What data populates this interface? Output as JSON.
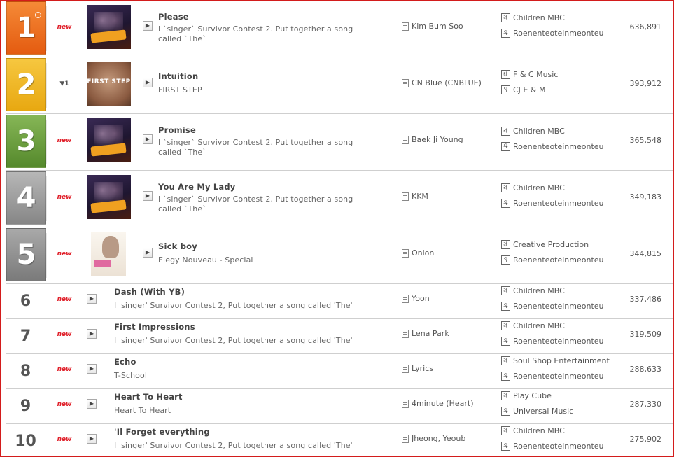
{
  "rows": [
    {
      "rank": "1",
      "change": "new",
      "title": "Please",
      "sub": "I `singer` Survivor Contest 2. Put together a song called `The`",
      "artist": "Kim Bum Soo",
      "label1": "Children MBC",
      "label2": "Roenenteoteinmeonteu",
      "count": "636,891",
      "color": "#ef6b1a"
    },
    {
      "rank": "2",
      "change": "▼1",
      "title": "Intuition",
      "sub": "FIRST STEP",
      "artist": "CN Blue (CNBLUE)",
      "label1": "F & C Music",
      "label2": "CJ E & M",
      "count": "393,912",
      "color": "#f1b21c"
    },
    {
      "rank": "3",
      "change": "new",
      "title": "Promise",
      "sub": "I `singer` Survivor Contest 2. Put together a song called `The`",
      "artist": "Baek Ji Young",
      "label1": "Children MBC",
      "label2": "Roenenteoteinmeonteu",
      "count": "365,548",
      "color": "#6aa23a"
    },
    {
      "rank": "4",
      "change": "new",
      "title": "You Are My Lady",
      "sub": "I `singer` Survivor Contest 2. Put together a song called `The`",
      "artist": "KKM",
      "label1": "Children MBC",
      "label2": "Roenenteoteinmeonteu",
      "count": "349,183",
      "color": "#9a9a9a"
    },
    {
      "rank": "5",
      "change": "new",
      "title": "Sick boy",
      "sub": "Elegy Nouveau - Special",
      "artist": "Onion",
      "label1": "Creative Production",
      "label2": "Roenenteoteinmeonteu",
      "count": "344,815",
      "color": "#8e8e8e"
    },
    {
      "rank": "6",
      "change": "new",
      "title": "Dash (With YB)",
      "sub": "I 'singer' Survivor Contest 2, Put together a song called 'The'",
      "artist": "Yoon",
      "label1": "Children MBC",
      "label2": "Roenenteoteinmeonteu",
      "count": "337,486"
    },
    {
      "rank": "7",
      "change": "new",
      "title": "First Impressions",
      "sub": "I 'singer' Survivor Contest 2, Put together a song called 'The'",
      "artist": "Lena Park",
      "label1": "Children MBC",
      "label2": "Roenenteoteinmeonteu",
      "count": "319,509"
    },
    {
      "rank": "8",
      "change": "new",
      "title": "Echo",
      "sub": "T-School",
      "artist": "Lyrics",
      "label1": "Soul Shop Entertainment",
      "label2": "Roenenteoteinmeonteu",
      "count": "288,633"
    },
    {
      "rank": "9",
      "change": "new",
      "title": "Heart To Heart",
      "sub": "Heart To Heart",
      "artist": "4minute (Heart)",
      "label1": "Play Cube",
      "label2": "Universal Music",
      "count": "287,330"
    },
    {
      "rank": "10",
      "change": "new",
      "title": "'Il Forget everything",
      "sub": "I 'singer' Survivor Contest 2, Put together a song called 'The'",
      "artist": "Jheong, Yeoub",
      "label1": "Children MBC",
      "label2": "Roenenteoteinmeonteu",
      "count": "275,902"
    }
  ],
  "thumbs": {
    "survivor": {
      "bg": "#2a1f3d",
      "accent": "#f0a020"
    },
    "firststep": {
      "text": "FIRST STEP",
      "bg": "#9b6b4f"
    },
    "onion": {
      "bg": "#f3ede5",
      "accent": "#e06aa0"
    }
  },
  "labels_icon_1": "레",
  "labels_icon_2": "유"
}
